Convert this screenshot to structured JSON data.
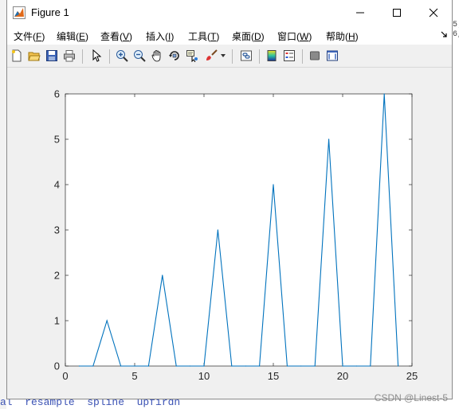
{
  "window": {
    "title": "Figure 1"
  },
  "menu": {
    "items": [
      {
        "label": "文件(",
        "key": "F",
        "tail": ")"
      },
      {
        "label": "编辑(",
        "key": "E",
        "tail": ")"
      },
      {
        "label": "查看(",
        "key": "V",
        "tail": ")"
      },
      {
        "label": "插入(",
        "key": "I",
        "tail": ")"
      },
      {
        "label": "工具(",
        "key": "T",
        "tail": ")"
      },
      {
        "label": "桌面(",
        "key": "D",
        "tail": ")"
      },
      {
        "label": "窗口(",
        "key": "W",
        "tail": ")"
      },
      {
        "label": "帮助(",
        "key": "H",
        "tail": ")"
      }
    ]
  },
  "toolbar": {
    "icons": [
      "new-figure-icon",
      "open-file-icon",
      "save-icon",
      "print-icon",
      "select-arrow-icon",
      "zoom-in-icon",
      "zoom-out-icon",
      "pan-hand-icon",
      "rotate-3d-icon",
      "data-cursor-icon",
      "brush-icon",
      "brush-dropdown-icon",
      "link-plot-icon",
      "colorbar-icon",
      "legend-icon",
      "hide-plot-tools-icon",
      "show-plot-tools-icon"
    ]
  },
  "background": {
    "code_line": "al  resample  spline  upfirdn",
    "right_text": [
      "5)",
      "6,"
    ]
  },
  "watermark": "CSDN @Linest-5",
  "colors": {
    "line": "#0072bd",
    "axes_bg": "#ffffff",
    "figure_bg": "#f0f0f0",
    "axis": "#262626"
  },
  "chart_data": {
    "type": "line",
    "title": "",
    "xlabel": "",
    "ylabel": "",
    "xlim": [
      0,
      25
    ],
    "ylim": [
      0,
      6
    ],
    "xticks": [
      0,
      5,
      10,
      15,
      20,
      25
    ],
    "yticks": [
      0,
      1,
      2,
      3,
      4,
      5,
      6
    ],
    "grid": false,
    "series": [
      {
        "x": [
          1,
          2,
          3,
          4,
          5,
          6,
          7,
          8,
          9,
          10,
          11,
          12,
          13,
          14,
          15,
          16,
          17,
          18,
          19,
          20,
          21,
          22,
          23,
          24
        ],
        "values": [
          0,
          0,
          1,
          0,
          0,
          0,
          2,
          0,
          0,
          0,
          3,
          0,
          0,
          0,
          4,
          0,
          0,
          0,
          5,
          0,
          0,
          0,
          6,
          0
        ]
      }
    ]
  }
}
